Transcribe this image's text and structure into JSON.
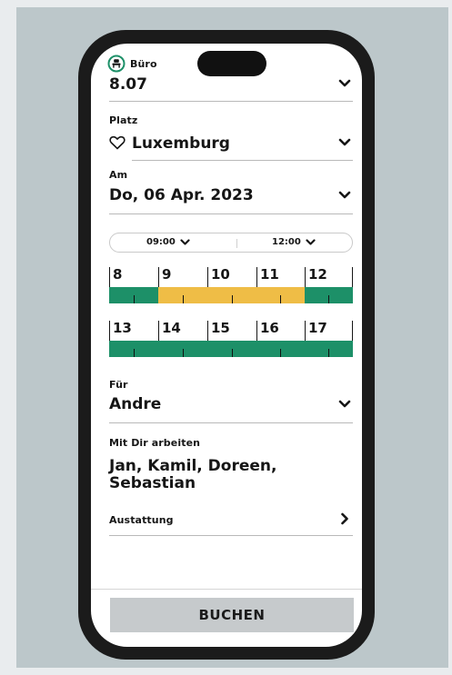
{
  "office": {
    "label": "Büro",
    "value": "8.07",
    "icon": "office-desk-icon"
  },
  "seat": {
    "label": "Platz",
    "value": "Luxemburg",
    "icon": "heart-outline-icon"
  },
  "date": {
    "label": "Am",
    "value": "Do, 06 Apr. 2023"
  },
  "time_range": {
    "start": "09:00",
    "end": "12:00"
  },
  "timeline": {
    "colors": {
      "free": "#1d9068",
      "selected": "#efbd46"
    },
    "rows": [
      {
        "hours": [
          "8",
          "9",
          "10",
          "11",
          "12"
        ],
        "segments": [
          {
            "status": "free",
            "from": 0,
            "to": 0.2
          },
          {
            "status": "selected",
            "from": 0.2,
            "to": 0.8
          },
          {
            "status": "free",
            "from": 0.8,
            "to": 1.0
          }
        ]
      },
      {
        "hours": [
          "13",
          "14",
          "15",
          "16",
          "17"
        ],
        "segments": [
          {
            "status": "free",
            "from": 0,
            "to": 1.0
          }
        ]
      }
    ]
  },
  "for": {
    "label": "Für",
    "value": "Andre"
  },
  "coworkers": {
    "label": "Mit Dir arbeiten",
    "line1": "Jan, Kamil, Doreen,",
    "line2": "Sebastian"
  },
  "equipment": {
    "label": "Austattung"
  },
  "book_button": {
    "label": "BUCHEN"
  }
}
